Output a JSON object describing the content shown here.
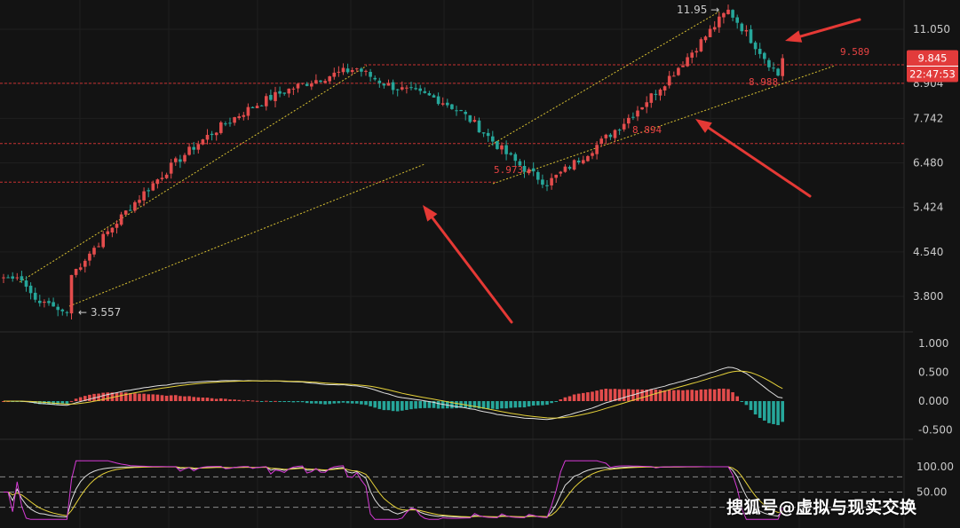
{
  "chart_data": [
    {
      "type": "candlestick",
      "ylim": [
        3.4,
        12.3
      ],
      "y_ticks": [
        "11.050",
        "9.845",
        "8.904",
        "7.742",
        "6.480",
        "5.424",
        "4.540",
        "3.800"
      ],
      "price_badge": {
        "value": "9.845",
        "time": "22:47:53",
        "color": "#e23b3b"
      },
      "annotations": [
        {
          "text": "11.95",
          "arrow": "→"
        },
        {
          "text": "9.589"
        },
        {
          "text": "8.988"
        },
        {
          "text": "8.894"
        },
        {
          "text": "5.973"
        },
        {
          "text": "3.557",
          "arrow": "←"
        }
      ],
      "key_prices": [
        3.557,
        4.05,
        9.45,
        5.973,
        11.95,
        8.988
      ],
      "horizontal_levels": [
        9.589,
        8.904,
        7.0,
        6.0
      ],
      "up_color": "#e34c4c",
      "down_color": "#26a69a",
      "level_color": "#c83232",
      "channel_color": "#d8c032",
      "arrow_color": "#e53935"
    },
    {
      "type": "macd",
      "ylim": [
        -0.62,
        1.05
      ],
      "y_ticks": [
        "1.000",
        "0.500",
        "0.000",
        "-0.500"
      ],
      "series": [
        {
          "color": "#e0e0e0"
        },
        {
          "color": "#e6d23a"
        },
        {
          "color": "#e34c4c"
        },
        {
          "color": "#26a69a"
        }
      ]
    },
    {
      "type": "kdj",
      "ylim": [
        -5,
        115
      ],
      "y_ticks": [
        "100.00",
        "50.00"
      ],
      "dashed_levels": [
        80,
        50,
        20
      ],
      "series": [
        {
          "color": "#e0e0e0"
        },
        {
          "color": "#e6d23a"
        },
        {
          "color": "#d63bd6"
        }
      ]
    }
  ],
  "watermark": "搜狐号@虚拟与现实交换"
}
